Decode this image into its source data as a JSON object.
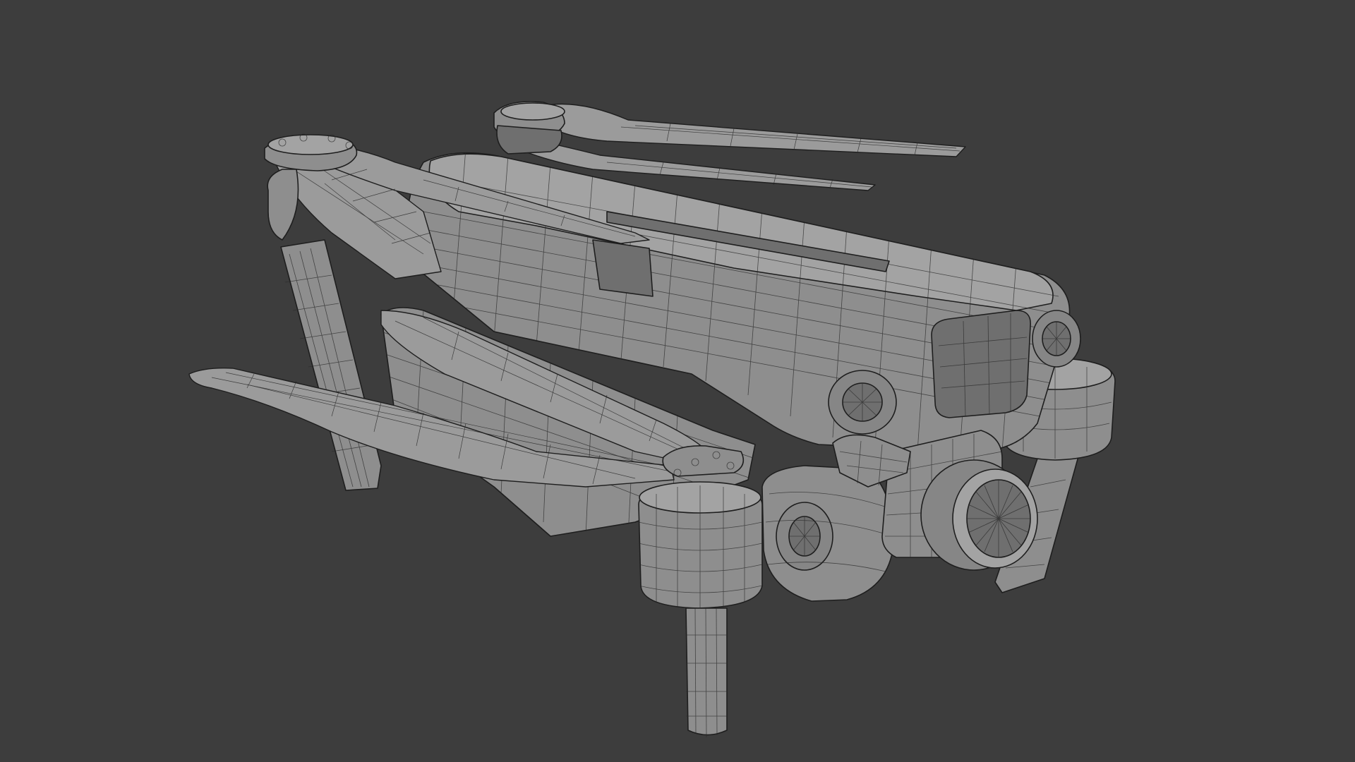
{
  "viewport": {
    "background_color": "#3d3d3d",
    "mesh_color": "#8e8e8e",
    "wire_color": "#1e1e1e",
    "subject": "wireframe-drone-model"
  }
}
